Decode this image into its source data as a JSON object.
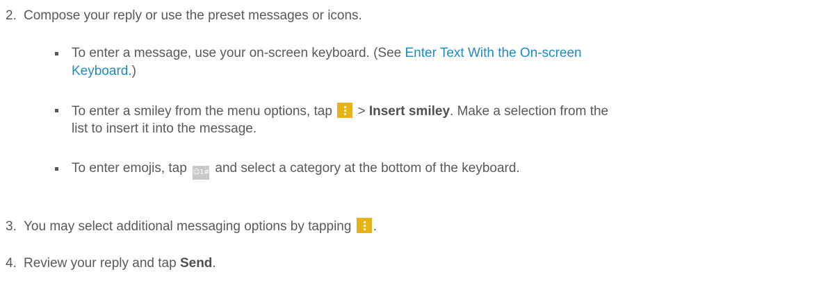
{
  "steps": [
    {
      "number": "2.",
      "text": "Compose your reply or use the preset messages or icons.",
      "bullets": [
        {
          "pre": "To enter a message, use your on-screen keyboard. (See ",
          "link_line1": "Enter Text With the On-screen",
          "link_line2": "Keyboard.",
          "post": ")"
        },
        {
          "pre": "To enter a smiley from the menu options, tap ",
          "sep": " > ",
          "bold": "Insert smiley",
          "post_line1": ". Make a selection from the",
          "line2": "list to insert it into the message.",
          "icon": "menu-icon"
        },
        {
          "pre": "To enter emojis, tap ",
          "icon": "emoji-icon",
          "icon_label": "☺1#",
          "post": " and select a category at the bottom of the keyboard."
        }
      ]
    },
    {
      "number": "3.",
      "text": "You may select additional messaging options by tapping ",
      "post": ".",
      "icon": "menu-icon"
    },
    {
      "number": "4.",
      "text": "Review your reply and tap ",
      "bold": "Send",
      "post": "."
    }
  ],
  "colors": {
    "text": "#595959",
    "link": "#1e8bc3",
    "menu_icon": "#e6b318",
    "emoji_icon": "#c8c8c8"
  }
}
